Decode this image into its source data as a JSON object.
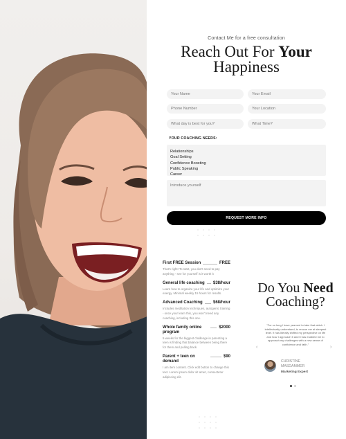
{
  "header": {
    "kicker": "Contact Me for a free consultation",
    "headline_line1_regular": "Reach Out For ",
    "headline_line1_bold": "Your",
    "headline_line2": "Happiness"
  },
  "form": {
    "your_name": "Your Name",
    "your_email": "Your Email",
    "phone": "Phone Number",
    "location": "Your Location",
    "day": "What day is best for you?",
    "time": "What Time?",
    "needs_label": "YOUR COACHING NEEDS:",
    "needs_options": [
      "Relationships",
      "Goal Setting",
      "Confidence Boosting",
      "Public Speaking",
      "Career"
    ],
    "introduce": "Introduce yourself",
    "submit": "REQUEST MORE INFO"
  },
  "sessions": [
    {
      "title": "First FREE Session",
      "price": "FREE",
      "desc": "That's right! To start, you don't need to pay anything - see for yourself is it worth it"
    },
    {
      "title": "General life coaching",
      "price": "$38/hour",
      "desc": "Learn how to organize your life and optimize your energy. Minimal weekly 15 hours for results."
    },
    {
      "title": "Advanced Coaching",
      "price": "$68/hour",
      "desc": "Includes meditation techniques, autogenic training - once your learn this, you won't need any coaching, including this one."
    },
    {
      "title": "Whole family online program",
      "price": "$2000",
      "desc": "5 weeks for the biggest challenge in parenting a teen is finding that balance between being there for them and pulling back."
    },
    {
      "title": "Parent + teen on demand",
      "price": "$90",
      "desc": "I am item content. Click edit button to change this text. Lorem ipsum dolor sit amet, consectetur adipiscing elit."
    }
  ],
  "testimonial": {
    "title_regular_1": "Do You ",
    "title_bold": "Need",
    "title_line2": "Coaching?",
    "quote": "\"For so long I have yearned to take that which I intellectually understand, to rescue me at sleepest level. It has literally shifted my perspective on life and how I approach it and it has enabled me to approach my challenges with a new sense of confidence and faith.\"",
    "name": "CHRISTINE MASDAMMER",
    "role": "Marketing Expert",
    "left_arrow": "‹",
    "right_arrow": "›"
  },
  "colors": {
    "accent": "#000000",
    "field_bg": "#f3f3f3",
    "background": "#ffffff"
  }
}
